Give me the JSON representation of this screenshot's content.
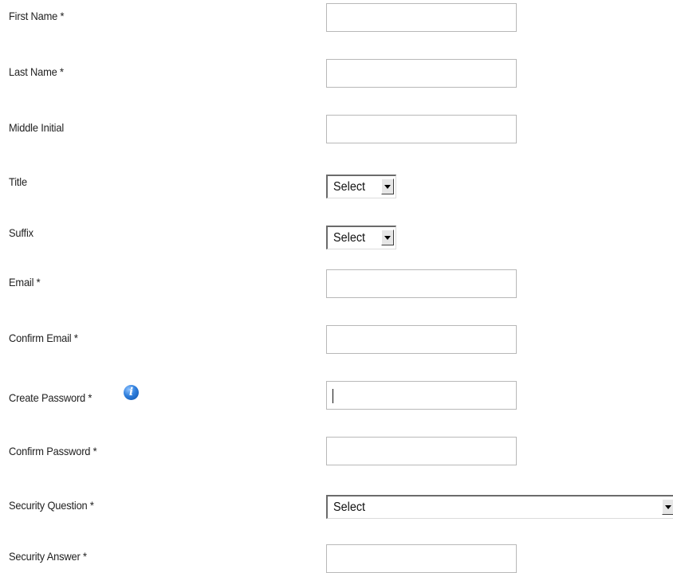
{
  "form": {
    "fields": [
      {
        "key": "first_name",
        "label": "First Name *",
        "type": "text",
        "value": ""
      },
      {
        "key": "last_name",
        "label": "Last Name *",
        "type": "text",
        "value": ""
      },
      {
        "key": "middle_initial",
        "label": "Middle Initial",
        "type": "text",
        "value": ""
      },
      {
        "key": "title",
        "label": "Title",
        "type": "select",
        "value": "Select"
      },
      {
        "key": "suffix",
        "label": "Suffix",
        "type": "select",
        "value": "Select"
      },
      {
        "key": "email",
        "label": "Email *",
        "type": "text",
        "value": ""
      },
      {
        "key": "confirm_email",
        "label": "Confirm Email *",
        "type": "text",
        "value": ""
      },
      {
        "key": "create_password",
        "label": "Create Password *",
        "type": "password",
        "value": "",
        "focused": true,
        "help_icon": "info-icon"
      },
      {
        "key": "confirm_password",
        "label": "Confirm Password *",
        "type": "password",
        "value": ""
      },
      {
        "key": "security_question",
        "label": "Security Question *",
        "type": "select",
        "value": "Select"
      },
      {
        "key": "security_answer",
        "label": "Security Answer *",
        "type": "text",
        "value": ""
      }
    ]
  },
  "icons": {
    "info": {
      "name": "info-icon",
      "glyph": "i",
      "color": "#2f7fdd"
    },
    "dropdown_arrow": {
      "name": "chevron-down-icon",
      "glyph": "▼"
    }
  },
  "colors": {
    "input_border": "#b8b8b8",
    "label_text": "#222222",
    "background": "#ffffff"
  }
}
